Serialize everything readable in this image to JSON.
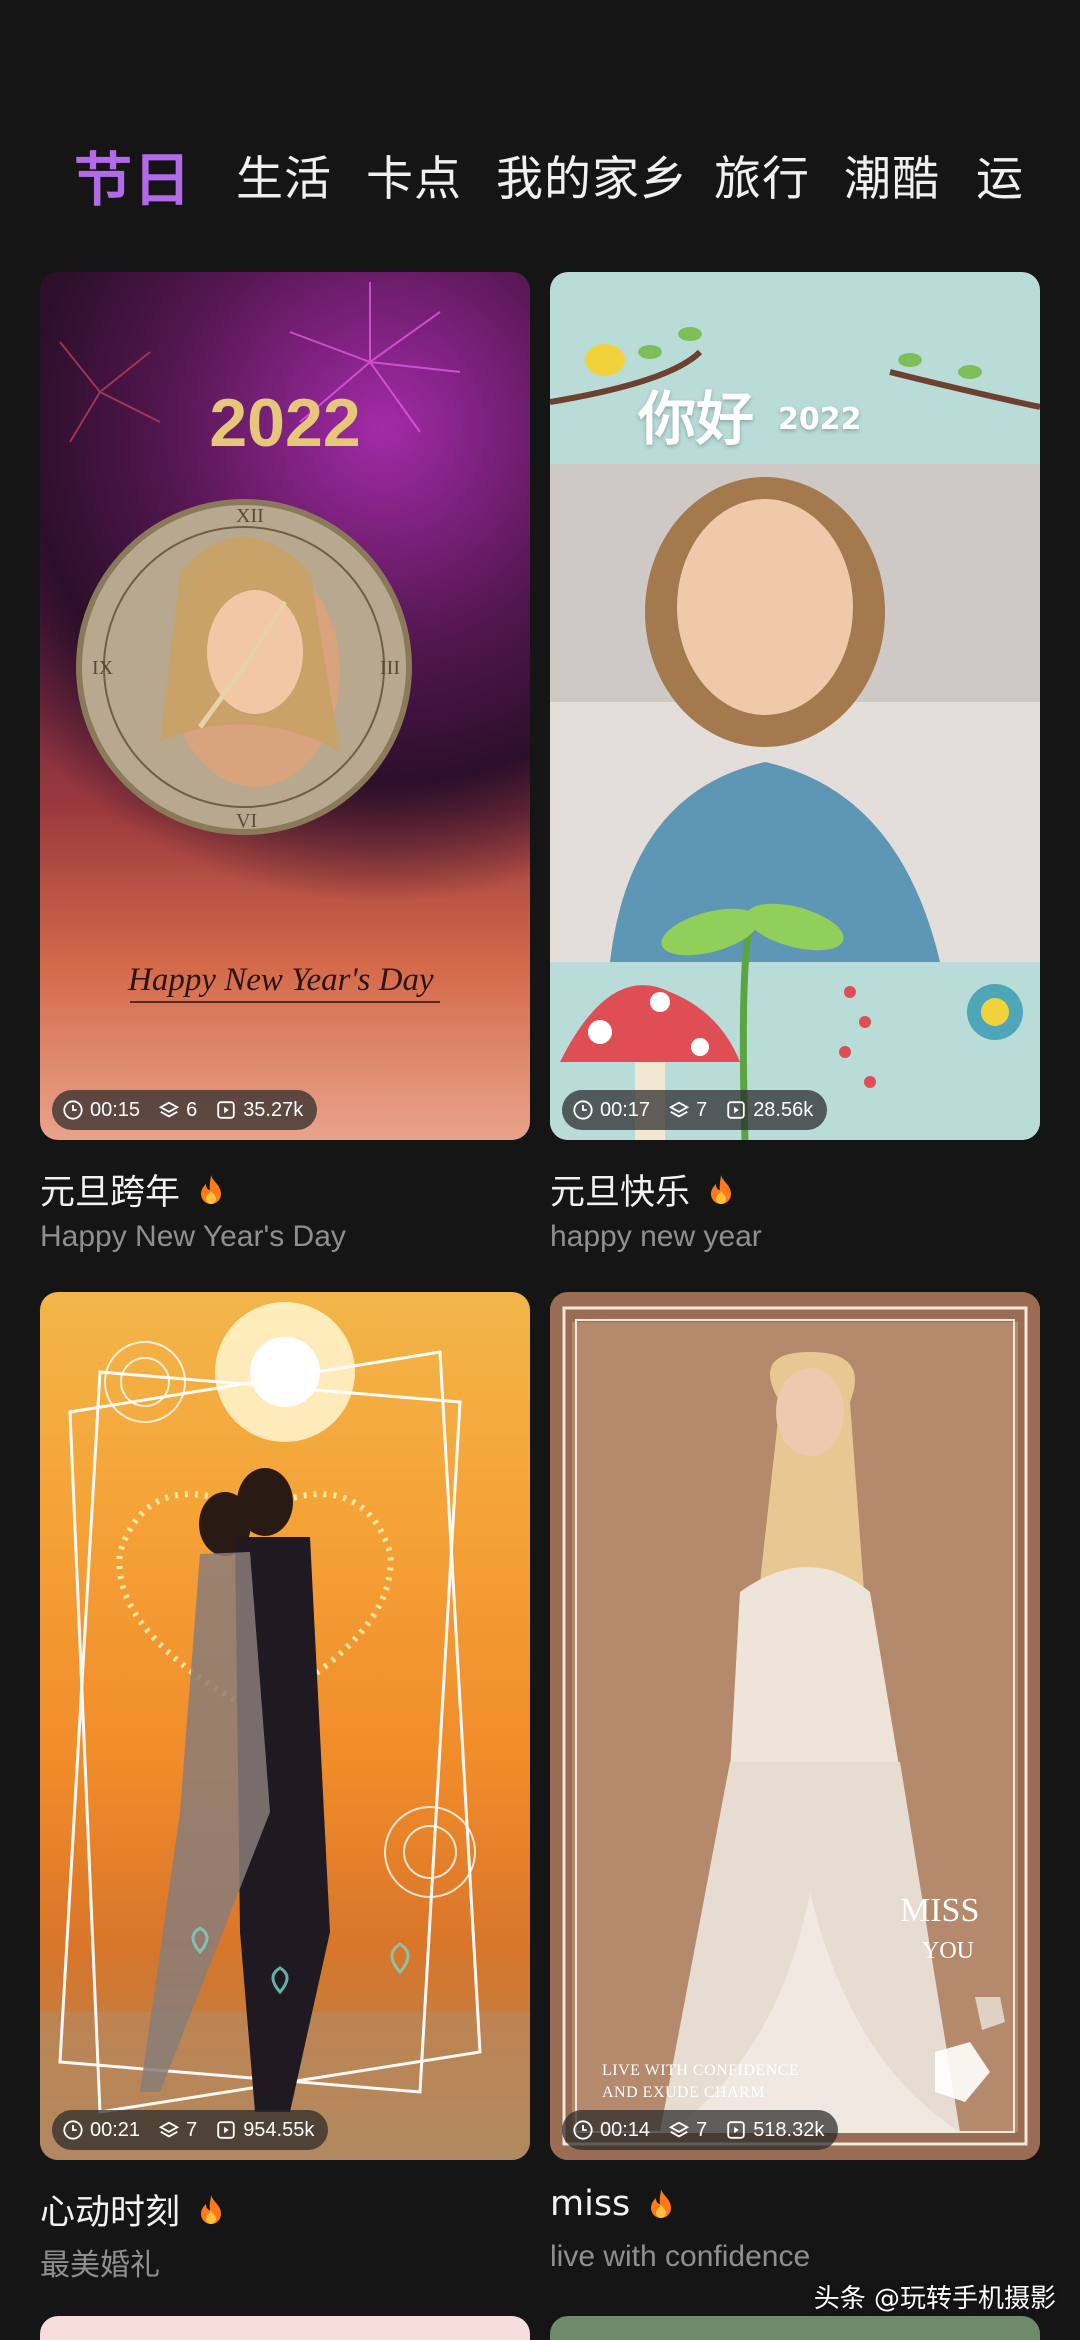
{
  "tabs": [
    {
      "label": "节日",
      "active": true
    },
    {
      "label": "生活",
      "active": false
    },
    {
      "label": "卡点",
      "active": false
    },
    {
      "label": "我的家乡",
      "active": false
    },
    {
      "label": "旅行",
      "active": false
    },
    {
      "label": "潮酷",
      "active": false
    },
    {
      "label": "运",
      "active": false
    }
  ],
  "colors": {
    "background": "#151515",
    "tab_active": "#b26ae8",
    "subtitle": "#8f8f8f"
  },
  "cards": [
    {
      "title": "元旦跨年",
      "subtitle": "Happy New Year's Day",
      "duration": "00:15",
      "layers": "6",
      "uses": "35.27k",
      "overlay": {
        "year": "2022",
        "script": "Happy New Year's Day"
      },
      "hot_icon": "fire-icon"
    },
    {
      "title": "元旦快乐",
      "subtitle": "happy new year",
      "duration": "00:17",
      "layers": "7",
      "uses": "28.56k",
      "overlay": {
        "greeting": "你好",
        "year": "2022"
      },
      "hot_icon": "fire-icon"
    },
    {
      "title": "心动时刻",
      "subtitle": "最美婚礼",
      "duration": "00:21",
      "layers": "7",
      "uses": "954.55k",
      "hot_icon": "fire-icon"
    },
    {
      "title": "miss",
      "subtitle": "live with confidence",
      "duration": "00:14",
      "layers": "7",
      "uses": "518.32k",
      "overlay": {
        "miss": "MISS",
        "you": "YOU",
        "line1": "LIVE WITH CONFIDENCE",
        "line2": "AND EXUDE CHARM"
      },
      "hot_icon": "fire-icon"
    }
  ],
  "watermark": "头条 @玩转手机摄影"
}
